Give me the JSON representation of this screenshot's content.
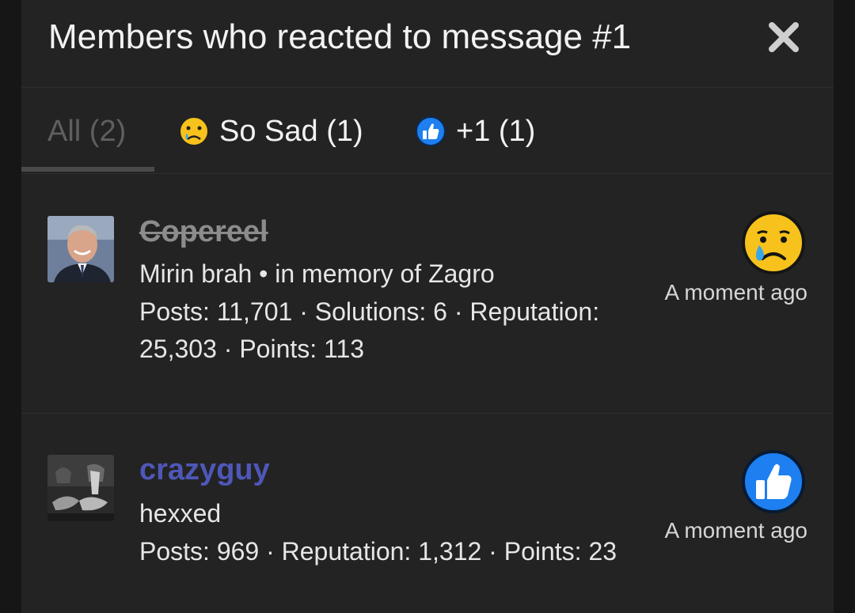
{
  "dialog": {
    "title": "Members who reacted to message #1"
  },
  "tabs": [
    {
      "label": "All (2)",
      "icon": "",
      "active": true
    },
    {
      "label": "So Sad (1)",
      "icon": "sad-crying-face-icon",
      "active": false
    },
    {
      "label": "+1 (1)",
      "icon": "thumbs-up-icon",
      "active": false
    }
  ],
  "members": [
    {
      "username": "Copereel",
      "banned": true,
      "user_title": "Mirin brah • in memory of Zagro",
      "stats_line1": "Posts: 11,701 · Solutions: 6 · Reputation:",
      "stats_line2": "25,303 · Points: 113",
      "reaction_icon": "sad-crying-face-icon",
      "time": "A moment ago"
    },
    {
      "username": "crazyguy",
      "banned": false,
      "user_title": "hexxed",
      "stats_line1": "Posts: 969 · Reputation: 1,312 · Points: 23",
      "reaction_icon": "thumbs-up-icon",
      "time": "A moment ago"
    }
  ],
  "colors": {
    "background": "#232323",
    "username_link": "#4e57b8",
    "banned_username": "#8c8c8c",
    "thumbs_up_blue": "#1d7ff0",
    "sad_yellow": "#f7c21b"
  }
}
